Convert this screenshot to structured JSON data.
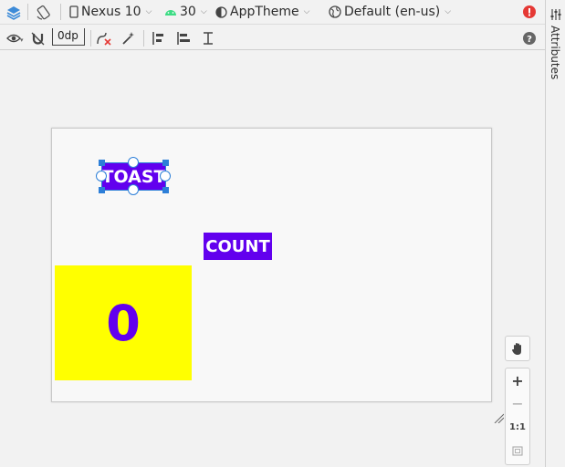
{
  "toolbar": {
    "device_label": "Nexus 10",
    "api_level": "30",
    "theme_label": "AppTheme",
    "locale_label": "Default (en-us)",
    "margin_value": "0dp"
  },
  "side_panel": {
    "label": "Attributes"
  },
  "design": {
    "toast_label": "TOAST",
    "count_label": "COUNT",
    "count_value": "0"
  },
  "zoom": {
    "one_to_one_label": "1:1",
    "plus_label": "+",
    "minus_label": "−"
  },
  "colors": {
    "accent": "#6200ee",
    "count_background": "#ffff00",
    "selection": "#2d7fd8",
    "error": "#e53935"
  },
  "icons": [
    "layers-icon",
    "orientation-icon",
    "phone-icon",
    "android-icon",
    "theme-icon",
    "globe-icon",
    "error-icon",
    "eye-icon",
    "magnet-icon",
    "clear-constraints-icon",
    "magic-wand-icon",
    "pack-icon",
    "align-icon",
    "guidelines-icon",
    "help-icon",
    "hand-icon",
    "fit-screen-icon"
  ]
}
